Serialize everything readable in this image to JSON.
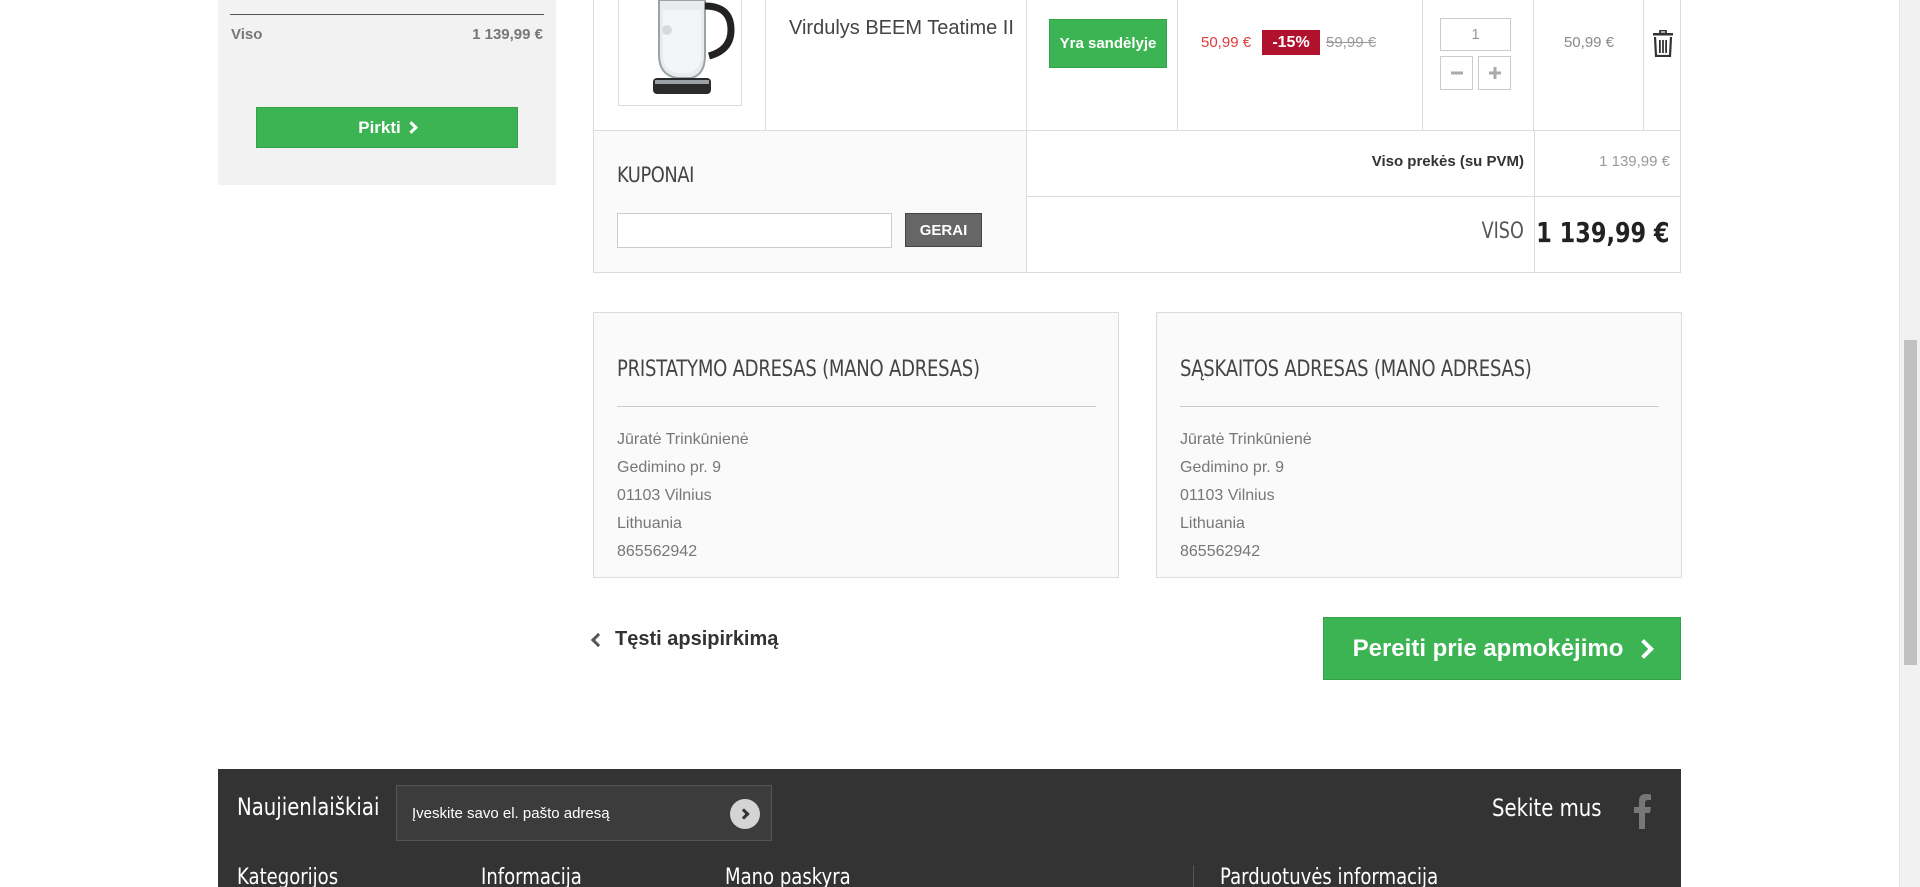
{
  "side_cart": {
    "viso_label": "Viso",
    "viso_value": "1 139,99 €",
    "buy_label": "Pirkti"
  },
  "product": {
    "name": "Virdulys BEEM Teatime II",
    "stock_label": "Yra sandėlyje",
    "price_new": "50,99 €",
    "discount": "-15%",
    "price_old": "59,99 €",
    "quantity": "1",
    "line_total": "50,99 €"
  },
  "coupon": {
    "title": "KUPONAI",
    "input_value": "",
    "apply_label": "GERAI"
  },
  "summary": {
    "items_label": "Viso prekės (su PVM)",
    "items_value": "1 139,99 €",
    "total_label": "VISO",
    "total_value": "1 139,99 €"
  },
  "delivery_address": {
    "title": "PRISTATYMO ADRESAS (MANO ADRESAS)",
    "name": "Jūratė Trinkūnienė",
    "street": "Gedimino pr. 9",
    "city": "01103 Vilnius",
    "country": "Lithuania",
    "phone": "865562942"
  },
  "billing_address": {
    "title": "SĄSKAITOS ADRESAS (MANO ADRESAS)",
    "name": "Jūratė Trinkūnienė",
    "street": "Gedimino pr. 9",
    "city": "01103 Vilnius",
    "country": "Lithuania",
    "phone": "865562942"
  },
  "nav": {
    "continue_label": "Tęsti apsipirkimą",
    "checkout_label": "Pereiti prie apmokėjimo"
  },
  "footer": {
    "newsletter_title": "Naujienlaiškiai",
    "newsletter_placeholder": "Įveskite savo el. pašto adresą",
    "follow_label": "Sekite mus",
    "col_categories": "Kategorijos",
    "col_info": "Informacija",
    "col_account": "Mano paskyra",
    "col_store": "Parduotuvės informacija"
  },
  "colors": {
    "accent_green": "#3cb454",
    "discount_red": "#b0112c",
    "price_red": "#e03b3b",
    "footer_bg": "#333333"
  },
  "icons": {
    "next": "chevron-right-icon",
    "back": "chevron-left-icon",
    "delete": "trash-icon",
    "decrement": "minus-icon",
    "increment": "plus-icon",
    "social": "facebook-icon",
    "submit": "circle-arrow-icon"
  }
}
